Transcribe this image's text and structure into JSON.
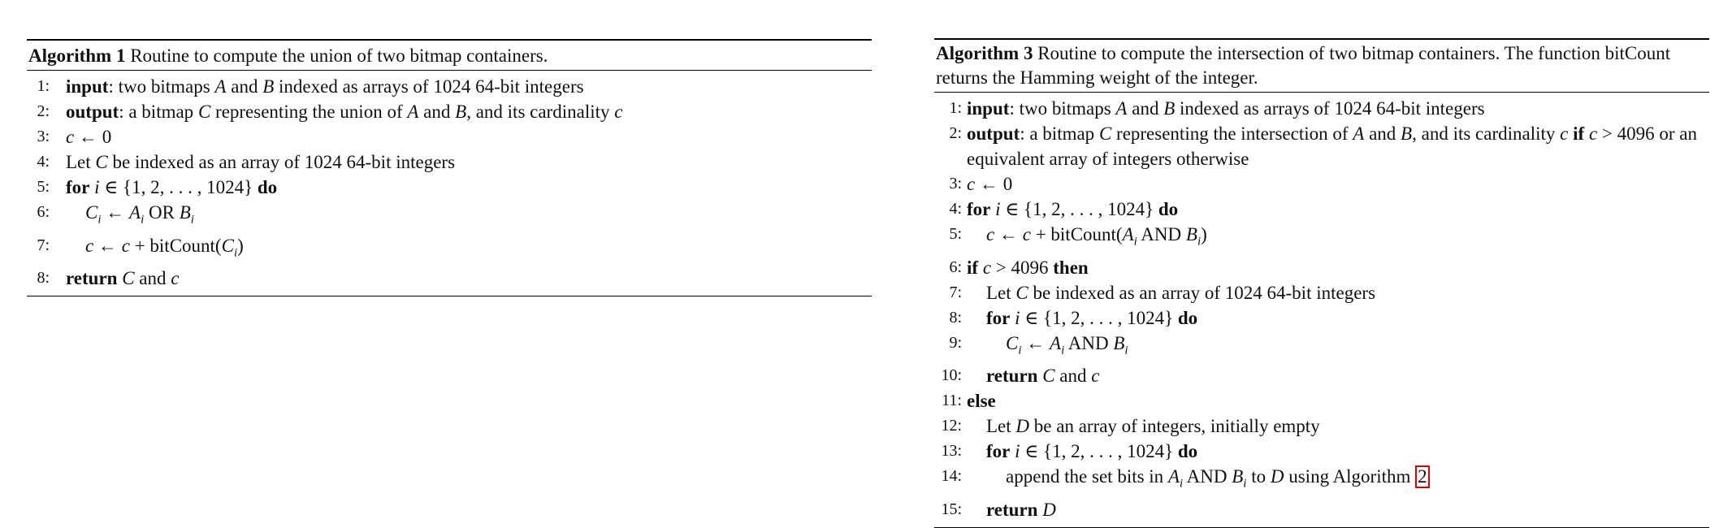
{
  "algorithm1": {
    "label": "Algorithm 1",
    "caption": "Routine to compute the union of two bitmap containers.",
    "lines": [
      {
        "no": "1:",
        "indent": 0,
        "parts": [
          {
            "t": "input",
            "s": "kw"
          },
          {
            "t": ": two bitmaps ",
            "s": ""
          },
          {
            "t": "A",
            "s": "m"
          },
          {
            "t": " and ",
            "s": ""
          },
          {
            "t": "B",
            "s": "m"
          },
          {
            "t": " indexed as arrays of 1024 64-bit integers",
            "s": ""
          }
        ]
      },
      {
        "no": "2:",
        "indent": 0,
        "parts": [
          {
            "t": "output",
            "s": "kw"
          },
          {
            "t": ": a bitmap ",
            "s": ""
          },
          {
            "t": "C",
            "s": "m"
          },
          {
            "t": " representing the union of ",
            "s": ""
          },
          {
            "t": "A",
            "s": "m"
          },
          {
            "t": " and ",
            "s": ""
          },
          {
            "t": "B",
            "s": "m"
          },
          {
            "t": ", and its cardinality ",
            "s": ""
          },
          {
            "t": "c",
            "s": "m"
          }
        ]
      },
      {
        "no": "3:",
        "indent": 0,
        "parts": [
          {
            "t": "c",
            "s": "m"
          },
          {
            "t": " ← 0",
            "s": ""
          }
        ]
      },
      {
        "no": "4:",
        "indent": 0,
        "parts": [
          {
            "t": "Let ",
            "s": ""
          },
          {
            "t": "C",
            "s": "m"
          },
          {
            "t": " be indexed as an array of 1024 64-bit integers",
            "s": ""
          }
        ]
      },
      {
        "no": "5:",
        "indent": 0,
        "parts": [
          {
            "t": "for",
            "s": "kw"
          },
          {
            "t": " ",
            "s": ""
          },
          {
            "t": "i",
            "s": "m"
          },
          {
            "t": " ∈ {1, 2, . . . , 1024} ",
            "s": ""
          },
          {
            "t": "do",
            "s": "kw"
          }
        ]
      },
      {
        "no": "6:",
        "indent": 1,
        "parts": [
          {
            "t": "C",
            "s": "m"
          },
          {
            "t": "i",
            "s": "sub"
          },
          {
            "t": " ← ",
            "s": ""
          },
          {
            "t": "A",
            "s": "m"
          },
          {
            "t": "i",
            "s": "sub"
          },
          {
            "t": " OR ",
            "s": ""
          },
          {
            "t": "B",
            "s": "m"
          },
          {
            "t": "i",
            "s": "sub"
          }
        ]
      },
      {
        "no": "7:",
        "indent": 1,
        "parts": [
          {
            "t": "c",
            "s": "m"
          },
          {
            "t": " ← ",
            "s": ""
          },
          {
            "t": "c",
            "s": "m"
          },
          {
            "t": " + bitCount(",
            "s": ""
          },
          {
            "t": "C",
            "s": "m"
          },
          {
            "t": "i",
            "s": "sub"
          },
          {
            "t": ")",
            "s": ""
          }
        ]
      },
      {
        "no": "8:",
        "indent": 0,
        "parts": [
          {
            "t": "return",
            "s": "kw"
          },
          {
            "t": " ",
            "s": ""
          },
          {
            "t": "C",
            "s": "m"
          },
          {
            "t": " and ",
            "s": ""
          },
          {
            "t": "c",
            "s": "m"
          }
        ]
      }
    ]
  },
  "algorithm3": {
    "label": "Algorithm 3",
    "caption": "Routine to compute the intersection of two bitmap containers. The function bitCount returns the Hamming weight of the integer.",
    "lines": [
      {
        "no": "1:",
        "indent": 0,
        "parts": [
          {
            "t": "input",
            "s": "kw"
          },
          {
            "t": ": two bitmaps ",
            "s": ""
          },
          {
            "t": "A",
            "s": "m"
          },
          {
            "t": " and ",
            "s": ""
          },
          {
            "t": "B",
            "s": "m"
          },
          {
            "t": " indexed as arrays of 1024 64-bit integers",
            "s": ""
          }
        ]
      },
      {
        "no": "2:",
        "indent": 0,
        "wrap": true,
        "parts": [
          {
            "t": "output",
            "s": "kw"
          },
          {
            "t": ": a bitmap ",
            "s": ""
          },
          {
            "t": "C",
            "s": "m"
          },
          {
            "t": " representing the intersection of ",
            "s": ""
          },
          {
            "t": "A",
            "s": "m"
          },
          {
            "t": " and ",
            "s": ""
          },
          {
            "t": "B",
            "s": "m"
          },
          {
            "t": ", and its cardinality ",
            "s": ""
          },
          {
            "t": "c",
            "s": "m"
          },
          {
            "t": " ",
            "s": ""
          },
          {
            "t": "if",
            "s": "kw"
          },
          {
            "t": " ",
            "s": ""
          },
          {
            "t": "c",
            "s": "m"
          },
          {
            "t": " > 4096 or an equivalent array of integers otherwise",
            "s": ""
          }
        ]
      },
      {
        "no": "3:",
        "indent": 0,
        "parts": [
          {
            "t": "c",
            "s": "m"
          },
          {
            "t": " ← 0",
            "s": ""
          }
        ]
      },
      {
        "no": "4:",
        "indent": 0,
        "parts": [
          {
            "t": "for",
            "s": "kw"
          },
          {
            "t": " ",
            "s": ""
          },
          {
            "t": "i",
            "s": "m"
          },
          {
            "t": " ∈ {1, 2, . . . , 1024} ",
            "s": ""
          },
          {
            "t": "do",
            "s": "kw"
          }
        ]
      },
      {
        "no": "5:",
        "indent": 1,
        "parts": [
          {
            "t": "c",
            "s": "m"
          },
          {
            "t": " ← ",
            "s": ""
          },
          {
            "t": "c",
            "s": "m"
          },
          {
            "t": " + bitCount(",
            "s": ""
          },
          {
            "t": "A",
            "s": "m"
          },
          {
            "t": "i",
            "s": "sub"
          },
          {
            "t": " AND ",
            "s": ""
          },
          {
            "t": "B",
            "s": "m"
          },
          {
            "t": "i",
            "s": "sub"
          },
          {
            "t": ")",
            "s": ""
          }
        ]
      },
      {
        "no": "6:",
        "indent": 0,
        "parts": [
          {
            "t": "if",
            "s": "kw"
          },
          {
            "t": " ",
            "s": ""
          },
          {
            "t": "c",
            "s": "m"
          },
          {
            "t": " > 4096 ",
            "s": ""
          },
          {
            "t": "then",
            "s": "kw"
          }
        ]
      },
      {
        "no": "7:",
        "indent": 1,
        "parts": [
          {
            "t": "Let ",
            "s": ""
          },
          {
            "t": "C",
            "s": "m"
          },
          {
            "t": " be indexed as an array of 1024 64-bit integers",
            "s": ""
          }
        ]
      },
      {
        "no": "8:",
        "indent": 1,
        "parts": [
          {
            "t": "for",
            "s": "kw"
          },
          {
            "t": " ",
            "s": ""
          },
          {
            "t": "i",
            "s": "m"
          },
          {
            "t": " ∈ {1, 2, . . . , 1024} ",
            "s": ""
          },
          {
            "t": "do",
            "s": "kw"
          }
        ]
      },
      {
        "no": "9:",
        "indent": 2,
        "parts": [
          {
            "t": "C",
            "s": "m"
          },
          {
            "t": "i",
            "s": "sub"
          },
          {
            "t": " ← ",
            "s": ""
          },
          {
            "t": "A",
            "s": "m"
          },
          {
            "t": "i",
            "s": "sub"
          },
          {
            "t": " AND ",
            "s": ""
          },
          {
            "t": "B",
            "s": "m"
          },
          {
            "t": "i",
            "s": "sub"
          }
        ]
      },
      {
        "no": "10:",
        "indent": 1,
        "parts": [
          {
            "t": "return",
            "s": "kw"
          },
          {
            "t": " ",
            "s": ""
          },
          {
            "t": "C",
            "s": "m"
          },
          {
            "t": " and ",
            "s": ""
          },
          {
            "t": "c",
            "s": "m"
          }
        ]
      },
      {
        "no": "11:",
        "indent": 0,
        "parts": [
          {
            "t": "else",
            "s": "kw"
          }
        ]
      },
      {
        "no": "12:",
        "indent": 1,
        "parts": [
          {
            "t": "Let ",
            "s": ""
          },
          {
            "t": "D",
            "s": "m"
          },
          {
            "t": " be an array of integers, initially empty",
            "s": ""
          }
        ]
      },
      {
        "no": "13:",
        "indent": 1,
        "parts": [
          {
            "t": "for",
            "s": "kw"
          },
          {
            "t": " ",
            "s": ""
          },
          {
            "t": "i",
            "s": "m"
          },
          {
            "t": " ∈ {1, 2, . . . , 1024} ",
            "s": ""
          },
          {
            "t": "do",
            "s": "kw"
          }
        ]
      },
      {
        "no": "14:",
        "indent": 2,
        "parts": [
          {
            "t": "append the set bits in ",
            "s": ""
          },
          {
            "t": "A",
            "s": "m"
          },
          {
            "t": "i",
            "s": "sub"
          },
          {
            "t": " AND ",
            "s": ""
          },
          {
            "t": "B",
            "s": "m"
          },
          {
            "t": "i",
            "s": "sub"
          },
          {
            "t": " to ",
            "s": ""
          },
          {
            "t": "D",
            "s": "m"
          },
          {
            "t": " using Algorithm ",
            "s": ""
          },
          {
            "t": "2",
            "s": "ref"
          }
        ]
      },
      {
        "no": "15:",
        "indent": 1,
        "parts": [
          {
            "t": "return",
            "s": "kw"
          },
          {
            "t": " ",
            "s": ""
          },
          {
            "t": "D",
            "s": "m"
          }
        ]
      }
    ]
  }
}
